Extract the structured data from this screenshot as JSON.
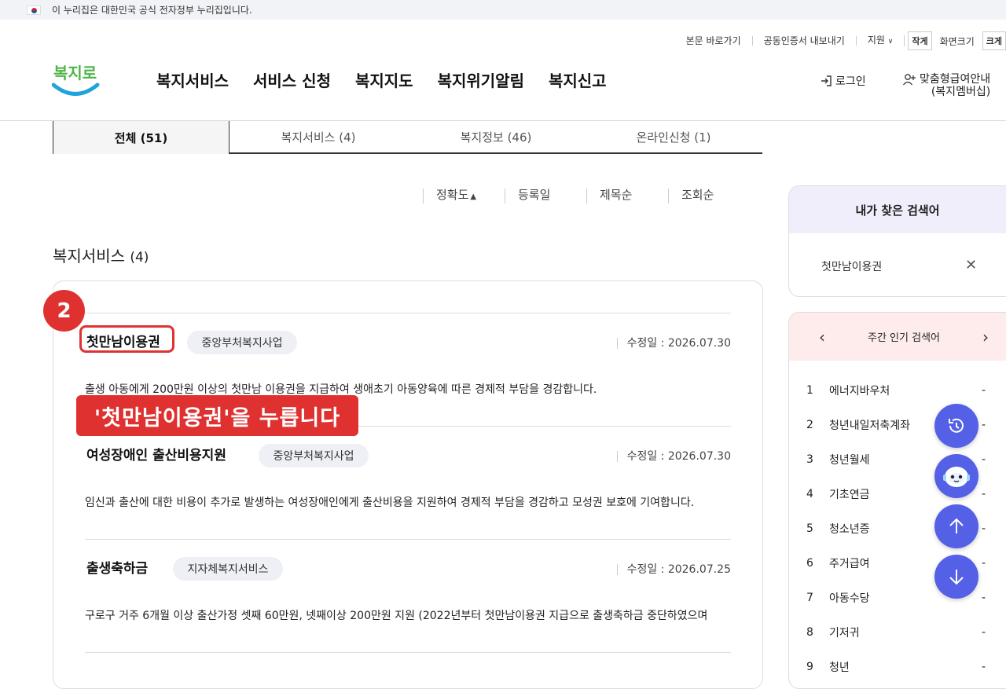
{
  "gov_bar": {
    "text": "이 누리집은 대한민국 공식 전자정부 누리집입니다."
  },
  "util": {
    "skip": "본문 바로가기",
    "cert": "공동인증서 내보내기",
    "support": "지원",
    "small": "작게",
    "screen": "화면크기",
    "large": "크게"
  },
  "logo": {
    "text": "복지로"
  },
  "gnb": [
    "복지서비스",
    "서비스 신청",
    "복지지도",
    "복지위기알림",
    "복지신고"
  ],
  "header": {
    "login": "로그인",
    "member_line1": "맞춤형급여안내",
    "member_line2": "(복지멤버십)"
  },
  "tabs": [
    "전체 (51)",
    "복지서비스 (4)",
    "복지정보 (46)",
    "온라인신청 (1)"
  ],
  "sort": [
    "정확도",
    "등록일",
    "제목순",
    "조회순"
  ],
  "section": {
    "title": "복지서비스",
    "count": "(4)"
  },
  "items": [
    {
      "name": "첫만남이용권",
      "tag": "중앙부처복지사업",
      "date": "수정일 : 2026.07.30",
      "desc": "출생 아동에게 200만원 이상의 첫만남 이용권을 지급하여 생애초기 아동양육에 따른 경제적 부담을 경감합니다."
    },
    {
      "name": "여성장애인 출산비용지원",
      "tag": "중앙부처복지사업",
      "date": "수정일 : 2026.07.30",
      "desc": "임신과 출산에 대한 비용이 추가로 발생하는 여성장애인에게 출산비용을 지원하여 경제적 부담을 경감하고 모성권 보호에 기여합니다."
    },
    {
      "name": "출생축하금",
      "tag": "지자체복지서비스",
      "date": "수정일 : 2026.07.25",
      "desc": "구로구 거주 6개월 이상 출산가정 셋째 60만원, 넷째이상 200만원 지원 (2022년부터 첫만남이용권 지급으로 출생축하금 중단하였으며"
    }
  ],
  "annotation": {
    "step": "2",
    "callout": "'첫만남이용권'을 누릅니다"
  },
  "my_search": {
    "title": "내가 찾은 검색어",
    "keyword": "첫만남이용권"
  },
  "popular": {
    "title": "주간 인기 검색어",
    "items": [
      {
        "rank": "1",
        "term": "에너지바우처"
      },
      {
        "rank": "2",
        "term": "청년내일저축계좌"
      },
      {
        "rank": "3",
        "term": "청년월세"
      },
      {
        "rank": "4",
        "term": "기초연금"
      },
      {
        "rank": "5",
        "term": "청소년증"
      },
      {
        "rank": "6",
        "term": "주거급여"
      },
      {
        "rank": "7",
        "term": "아동수당"
      },
      {
        "rank": "8",
        "term": "기저귀"
      },
      {
        "rank": "9",
        "term": "청년"
      }
    ],
    "dash": "-"
  },
  "colors": {
    "accent_red": "#e03131",
    "fab_blue": "#5460e6",
    "logo_blue": "#1fa3dc",
    "logo_green": "#4cb648"
  }
}
